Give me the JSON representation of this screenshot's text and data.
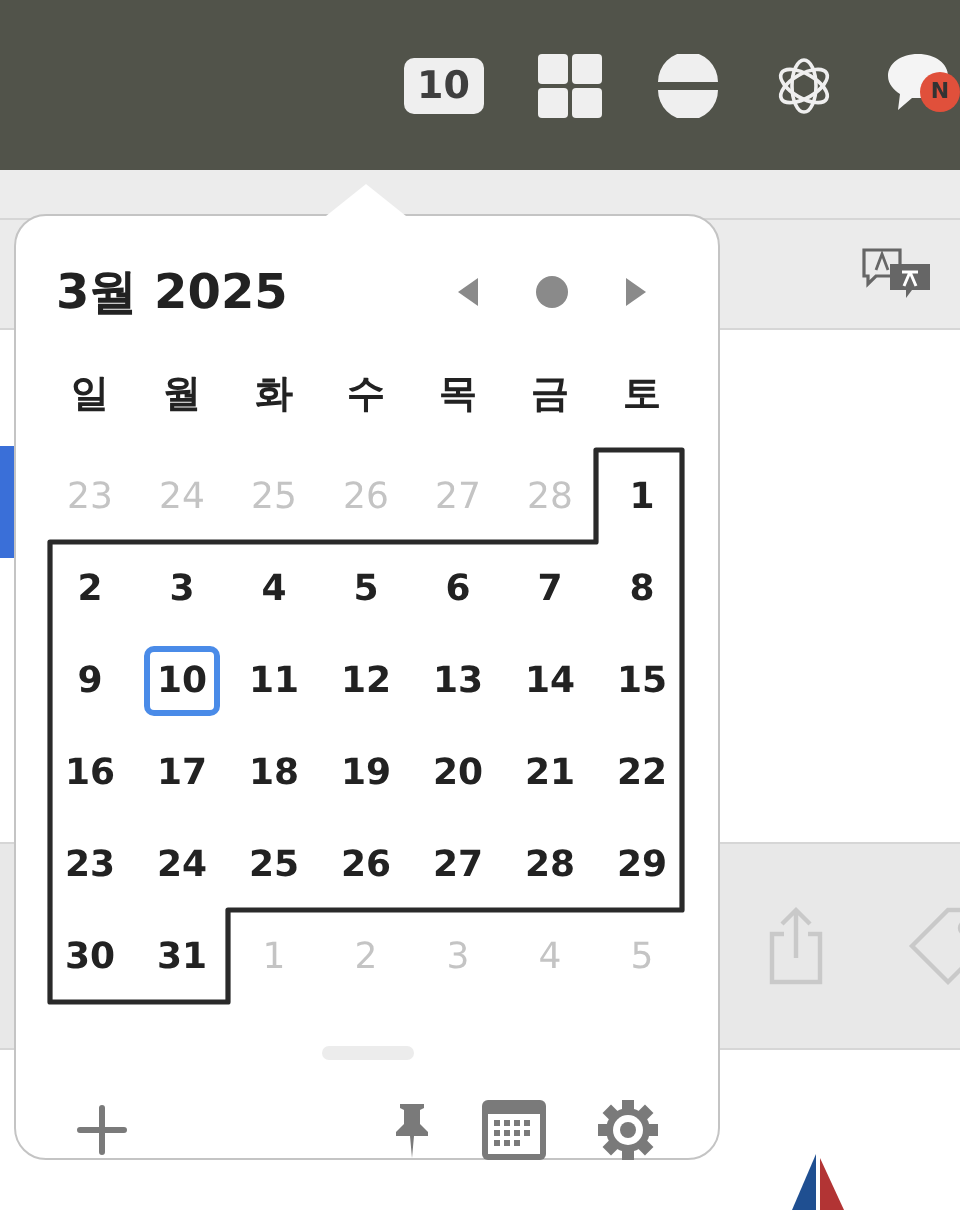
{
  "menu_bar": {
    "date_badge": "10",
    "notification_badge": "N"
  },
  "calendar": {
    "title": "3월 2025",
    "weekdays": [
      "일",
      "월",
      "화",
      "수",
      "목",
      "금",
      "토"
    ],
    "days": [
      {
        "label": "23",
        "in_month": false,
        "today": false
      },
      {
        "label": "24",
        "in_month": false,
        "today": false
      },
      {
        "label": "25",
        "in_month": false,
        "today": false
      },
      {
        "label": "26",
        "in_month": false,
        "today": false
      },
      {
        "label": "27",
        "in_month": false,
        "today": false
      },
      {
        "label": "28",
        "in_month": false,
        "today": false
      },
      {
        "label": "1",
        "in_month": true,
        "today": false
      },
      {
        "label": "2",
        "in_month": true,
        "today": false
      },
      {
        "label": "3",
        "in_month": true,
        "today": false
      },
      {
        "label": "4",
        "in_month": true,
        "today": false
      },
      {
        "label": "5",
        "in_month": true,
        "today": false
      },
      {
        "label": "6",
        "in_month": true,
        "today": false
      },
      {
        "label": "7",
        "in_month": true,
        "today": false
      },
      {
        "label": "8",
        "in_month": true,
        "today": false
      },
      {
        "label": "9",
        "in_month": true,
        "today": false
      },
      {
        "label": "10",
        "in_month": true,
        "today": true
      },
      {
        "label": "11",
        "in_month": true,
        "today": false
      },
      {
        "label": "12",
        "in_month": true,
        "today": false
      },
      {
        "label": "13",
        "in_month": true,
        "today": false
      },
      {
        "label": "14",
        "in_month": true,
        "today": false
      },
      {
        "label": "15",
        "in_month": true,
        "today": false
      },
      {
        "label": "16",
        "in_month": true,
        "today": false
      },
      {
        "label": "17",
        "in_month": true,
        "today": false
      },
      {
        "label": "18",
        "in_month": true,
        "today": false
      },
      {
        "label": "19",
        "in_month": true,
        "today": false
      },
      {
        "label": "20",
        "in_month": true,
        "today": false
      },
      {
        "label": "21",
        "in_month": true,
        "today": false
      },
      {
        "label": "22",
        "in_month": true,
        "today": false
      },
      {
        "label": "23",
        "in_month": true,
        "today": false
      },
      {
        "label": "24",
        "in_month": true,
        "today": false
      },
      {
        "label": "25",
        "in_month": true,
        "today": false
      },
      {
        "label": "26",
        "in_month": true,
        "today": false
      },
      {
        "label": "27",
        "in_month": true,
        "today": false
      },
      {
        "label": "28",
        "in_month": true,
        "today": false
      },
      {
        "label": "29",
        "in_month": true,
        "today": false
      },
      {
        "label": "30",
        "in_month": true,
        "today": false
      },
      {
        "label": "31",
        "in_month": true,
        "today": false
      },
      {
        "label": "1",
        "in_month": false,
        "today": false
      },
      {
        "label": "2",
        "in_month": false,
        "today": false
      },
      {
        "label": "3",
        "in_month": false,
        "today": false
      },
      {
        "label": "4",
        "in_month": false,
        "today": false
      },
      {
        "label": "5",
        "in_month": false,
        "today": false
      }
    ]
  }
}
